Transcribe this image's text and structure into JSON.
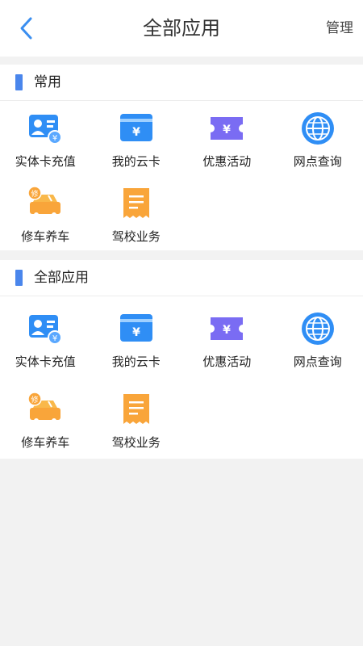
{
  "header": {
    "title": "全部应用",
    "manage_label": "管理"
  },
  "sections": [
    {
      "title": "常用",
      "apps": [
        {
          "label": "实体卡充值",
          "icon": "card-recharge-icon"
        },
        {
          "label": "我的云卡",
          "icon": "cloud-card-icon"
        },
        {
          "label": "优惠活动",
          "icon": "coupon-ticket-icon"
        },
        {
          "label": "网点查询",
          "icon": "globe-icon"
        },
        {
          "label": "修车养车",
          "icon": "car-repair-icon",
          "badge": "修"
        },
        {
          "label": "驾校业务",
          "icon": "receipt-icon"
        }
      ]
    },
    {
      "title": "全部应用",
      "apps": [
        {
          "label": "实体卡充值",
          "icon": "card-recharge-icon"
        },
        {
          "label": "我的云卡",
          "icon": "cloud-card-icon"
        },
        {
          "label": "优惠活动",
          "icon": "coupon-ticket-icon"
        },
        {
          "label": "网点查询",
          "icon": "globe-icon"
        },
        {
          "label": "修车养车",
          "icon": "car-repair-icon",
          "badge": "修"
        },
        {
          "label": "驾校业务",
          "icon": "receipt-icon"
        }
      ]
    }
  ],
  "colors": {
    "accent": "#4a86ec",
    "blue_icon": "#2f8ef5",
    "purple_icon": "#7a6cf3",
    "orange_icon": "#f9a53a",
    "background": "#f2f2f2"
  },
  "currency_symbol": "¥"
}
